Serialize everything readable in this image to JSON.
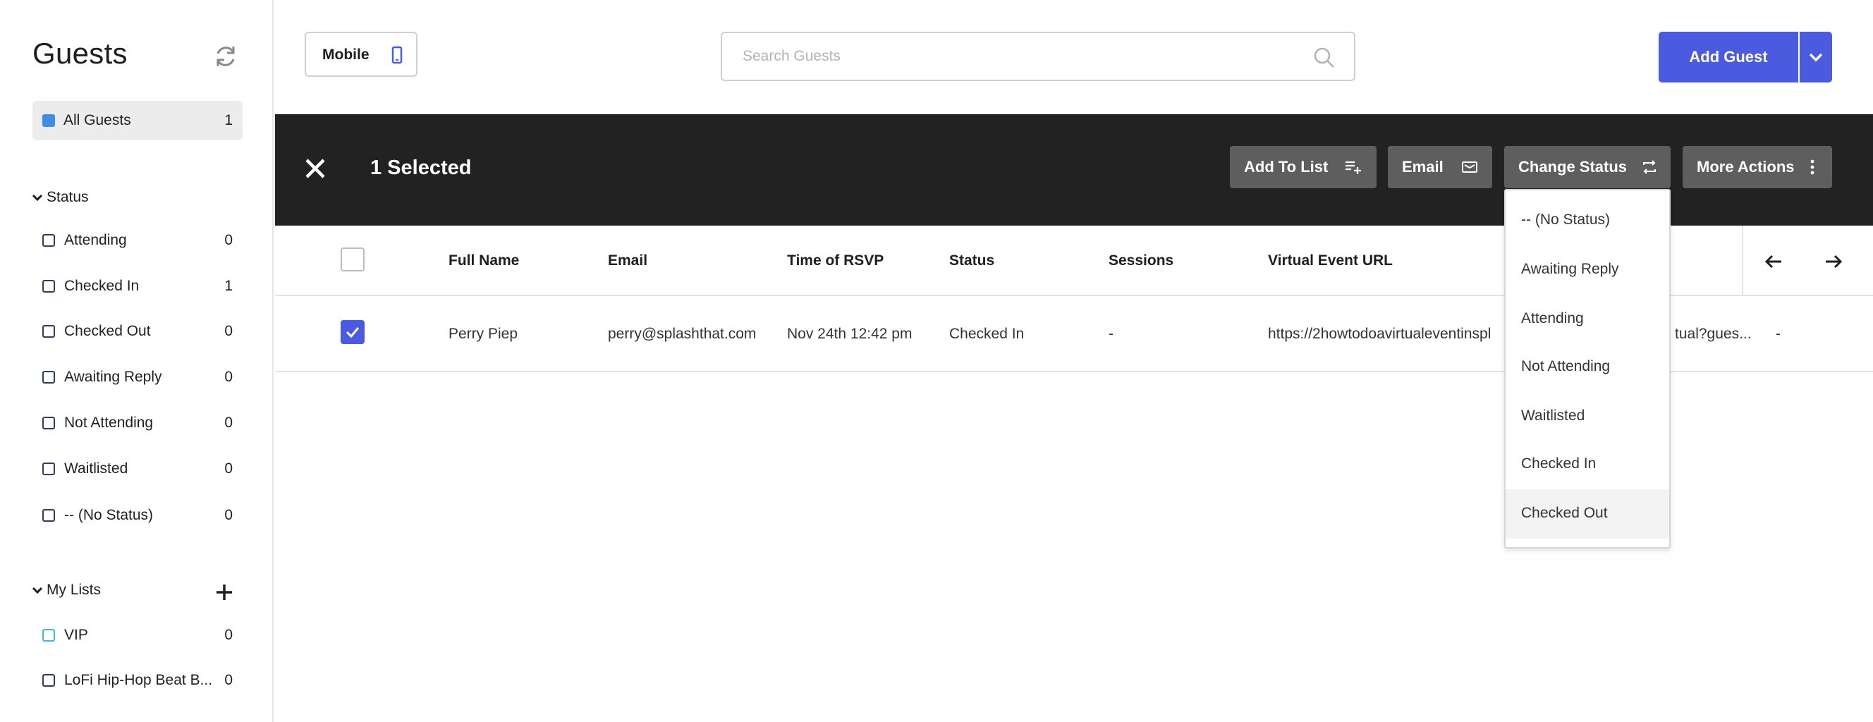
{
  "sidebar": {
    "title": "Guests",
    "all_guests": {
      "label": "All Guests",
      "count": "1"
    },
    "status_section": {
      "heading": "Status",
      "items": [
        {
          "label": "Attending",
          "count": "0"
        },
        {
          "label": "Checked In",
          "count": "1"
        },
        {
          "label": "Checked Out",
          "count": "0"
        },
        {
          "label": "Awaiting Reply",
          "count": "0"
        },
        {
          "label": "Not Attending",
          "count": "0"
        },
        {
          "label": "Waitlisted",
          "count": "0"
        },
        {
          "label": "-- (No Status)",
          "count": "0"
        }
      ]
    },
    "lists_section": {
      "heading": "My Lists",
      "items": [
        {
          "label": "VIP",
          "count": "0"
        },
        {
          "label": "LoFi Hip-Hop Beat B...",
          "count": "0"
        }
      ]
    }
  },
  "toolbar": {
    "mobile_label": "Mobile",
    "search_placeholder": "Search Guests",
    "add_guest_label": "Add Guest"
  },
  "selection_bar": {
    "selected_text": "1 Selected",
    "actions": {
      "add_to_list": "Add To List",
      "email": "Email",
      "change_status": "Change Status",
      "more_actions": "More Actions"
    }
  },
  "status_dropdown": {
    "options": [
      "-- (No Status)",
      "Awaiting Reply",
      "Attending",
      "Not Attending",
      "Waitlisted",
      "Checked In",
      "Checked Out"
    ],
    "hovered": "Checked Out"
  },
  "table": {
    "columns": [
      "Full Name",
      "Email",
      "Time of RSVP",
      "Status",
      "Sessions",
      "Virtual Event URL"
    ],
    "rows": [
      {
        "full_name": "Perry Piep",
        "email": "perry@splashthat.com",
        "time_of_rsvp": "Nov 24th 12:42 pm",
        "status": "Checked In",
        "sessions": "-",
        "virtual_event_url": "https://2howtodoavirtualeventinspl",
        "url_tail": "tual?gues...",
        "extra": "-",
        "selected": true
      }
    ]
  },
  "colors": {
    "accent": "#4a5be0",
    "selection_bar": "#222222",
    "action_button": "#5e5e5e",
    "all_guests_dot": "#3f8de6"
  }
}
